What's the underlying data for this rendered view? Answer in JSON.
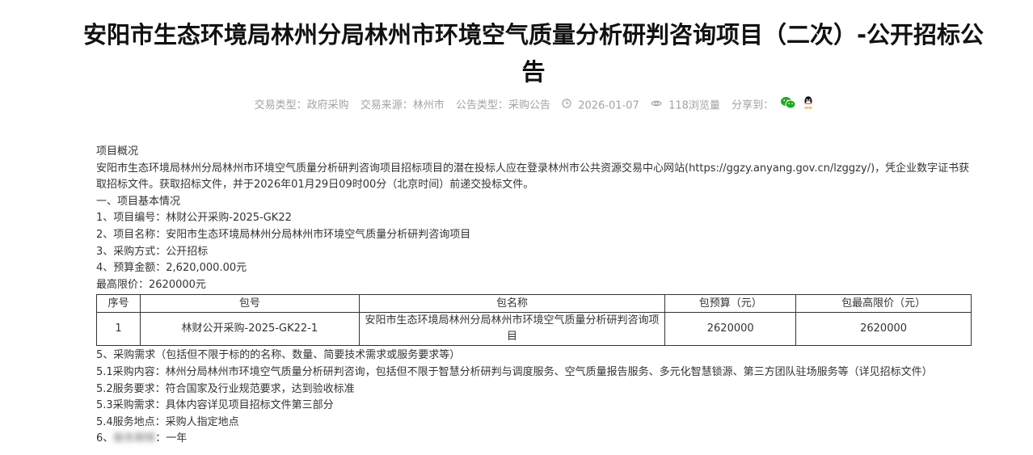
{
  "title": "安阳市生态环境局林州分局林州市环境空气质量分析研判咨询项目（二次）-公开招标公告",
  "meta": {
    "trade_type": "交易类型：政府采购",
    "trade_source": "交易来源：林州市",
    "notice_type": "公告类型：采购公告",
    "date": "2026-01-07",
    "views": "118浏览量",
    "share_label": "分享到：",
    "icons": [
      "clock-icon",
      "eye-icon",
      "wechat-icon",
      "qq-icon"
    ],
    "colors": {
      "wechat": "#1aad19",
      "meta_text": "#a3a3a3"
    }
  },
  "content": {
    "overview_heading": "项目概况",
    "overview_text": "安阳市生态环境局林州分局林州市环境空气质量分析研判咨询项目招标项目的潜在投标人应在登录林州市公共资源交易中心网站(https://ggzy.anyang.gov.cn/lzggzy/)，凭企业数字证书获取招标文件。获取招标文件，并于2026年01月29日09时00分（北京时间）前递交投标文件。",
    "section1": "一、项目基本情况",
    "item1": "1、项目编号：林财公开采购-2025-GK22",
    "item2": "2、项目名称：安阳市生态环境局林州分局林州市环境空气质量分析研判咨询项目",
    "item3": "3、采购方式：公开招标",
    "item4": "4、预算金额：2,620,000.00元",
    "max_price": "最高限价：2620000元",
    "table": {
      "headers": [
        "序号",
        "包号",
        "包名称",
        "包预算（元）",
        "包最高限价（元）"
      ],
      "rows": [
        [
          "1",
          "林财公开采购-2025-GK22-1",
          "安阳市生态环境局林州分局林州市环境空气质量分析研判咨询项目",
          "2620000",
          "2620000"
        ]
      ]
    },
    "item5": "5、采购需求（包括但不限于标的的名称、数量、简要技术需求或服务要求等）",
    "item5_1": "5.1采购内容：林州分局林州市环境空气质量分析研判咨询，包括但不限于智慧分析研判与调度服务、空气质量报告服务、多元化智慧锁源、第三方团队驻场服务等（详见招标文件）",
    "item5_2": "5.2服务要求：符合国家及行业规范要求，达到验收标准",
    "item5_3": "5.3采购需求：具体内容详见项目招标文件第三部分",
    "item5_4": "5.4服务地点：采购人指定地点",
    "item6_prefix": "6、",
    "item6_blurred": "服务期限",
    "item6_suffix": "：一年"
  }
}
